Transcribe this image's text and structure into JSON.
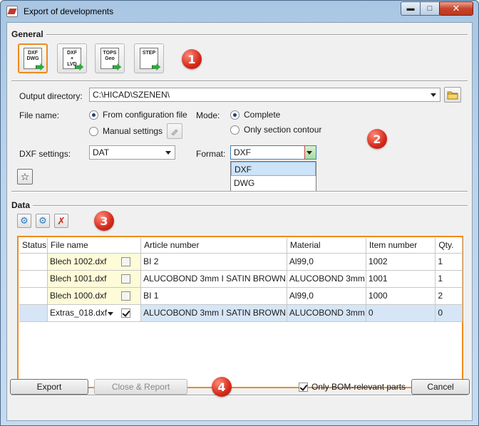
{
  "window": {
    "title": "Export of developments"
  },
  "general": {
    "section_title": "General",
    "format_buttons": [
      {
        "line1": "DXF",
        "line2": "DWG",
        "line3": ""
      },
      {
        "line1": "DXF",
        "line2": "+",
        "line3": "LVD"
      },
      {
        "line1": "TOPS",
        "line2": "Geo",
        "line3": ""
      },
      {
        "line1": "STEP",
        "line2": "",
        "line3": ""
      }
    ],
    "badge": "1"
  },
  "settings": {
    "output_dir_label": "Output directory:",
    "output_dir_value": "C:\\HICAD\\SZENEN\\",
    "file_name_label": "File name:",
    "file_name_opt1": "From configuration file",
    "file_name_opt2": "Manual settings",
    "mode_label": "Mode:",
    "mode_opt1": "Complete",
    "mode_opt2": "Only section contour",
    "dxf_settings_label": "DXF settings:",
    "dxf_settings_value": "DAT",
    "format_label": "Format:",
    "format_value": "DXF",
    "format_options": [
      "DXF",
      "DWG"
    ],
    "badge": "2"
  },
  "data": {
    "section_title": "Data",
    "badge": "3",
    "columns": [
      "Status",
      "File name",
      "Article number",
      "Material",
      "Item number",
      "Qty."
    ],
    "rows": [
      {
        "status": "",
        "file": "Blech 1002.dxf",
        "article": "BI 2",
        "material": "Al99,0",
        "item": "1002",
        "qty": "1",
        "checked": false
      },
      {
        "status": "",
        "file": "Blech 1001.dxf",
        "article": "ALUCOBOND 3mm I SATIN BROWN",
        "material": "ALUCOBOND 3mm",
        "item": "1001",
        "qty": "1",
        "checked": false
      },
      {
        "status": "",
        "file": "Blech 1000.dxf",
        "article": "BI 1",
        "material": "Al99,0",
        "item": "1000",
        "qty": "2",
        "checked": false
      },
      {
        "status": "",
        "file": "Extras_018.dxf",
        "article": "ALUCOBOND 3mm I SATIN BROWN",
        "material": "ALUCOBOND 3mm",
        "item": "0",
        "qty": "0",
        "checked": true
      }
    ]
  },
  "footer": {
    "export_label": "Export",
    "close_report_label": "Close & Report",
    "badge": "4",
    "only_bom_label": "Only BOM-relevant parts",
    "only_bom_checked": true,
    "cancel_label": "Cancel"
  }
}
